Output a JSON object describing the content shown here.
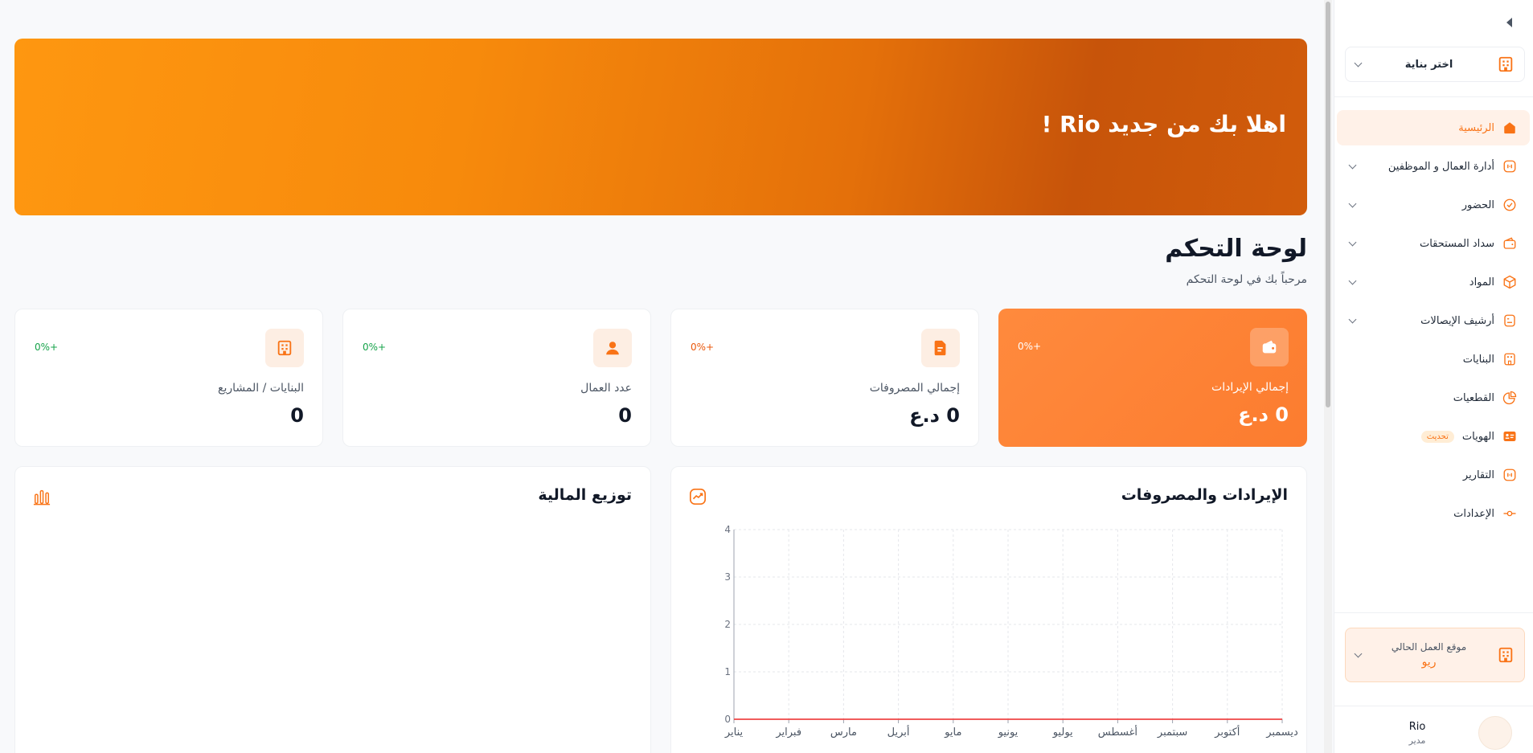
{
  "sidebar": {
    "building_select": {
      "label": "اختر بناية"
    },
    "nav": [
      {
        "label": "الرئيسية",
        "active": true,
        "icon": "home-icon",
        "has_submenu": false
      },
      {
        "label": "أدارة العمال و الموظفين",
        "icon": "users-icon",
        "has_submenu": true
      },
      {
        "label": "الحضور",
        "icon": "check-circle-icon",
        "has_submenu": true
      },
      {
        "label": "سداد المستحقات",
        "icon": "wallet-icon",
        "has_submenu": true
      },
      {
        "label": "المواد",
        "icon": "box-icon",
        "has_submenu": true
      },
      {
        "label": "أرشيف الإيصالات",
        "icon": "receipt-icon",
        "has_submenu": true
      },
      {
        "label": "البنايات",
        "icon": "building-icon",
        "has_submenu": false
      },
      {
        "label": "القطعيات",
        "icon": "pie-icon",
        "has_submenu": false
      },
      {
        "label": "الهويات",
        "icon": "id-card-icon",
        "has_submenu": false,
        "badge": "تحديث"
      },
      {
        "label": "التقارير",
        "icon": "report-icon",
        "has_submenu": false
      },
      {
        "label": "الإعدادات",
        "icon": "settings-icon",
        "has_submenu": false
      }
    ],
    "location": {
      "title": "موقع العمل الحالي",
      "value": "ريو"
    },
    "user": {
      "name": "Rio",
      "role": "مدير"
    }
  },
  "banner": {
    "greeting": "اهلا بك من جديد Rio !"
  },
  "page": {
    "title": "لوحة التحكم",
    "subtitle": "مرحباً بك في لوحة التحكم"
  },
  "stats": [
    {
      "label": "إجمالي الإيرادات",
      "value": "0 د.ع",
      "change": "+0%",
      "icon": "wallet-icon"
    },
    {
      "label": "إجمالي المصروفات",
      "value": "0 د.ع",
      "change": "+0%",
      "icon": "document-icon"
    },
    {
      "label": "عدد العمال",
      "value": "0",
      "change": "+0%",
      "icon": "user-icon"
    },
    {
      "label": "البنايات / المشاريع",
      "value": "0",
      "change": "+0%",
      "icon": "building-icon"
    }
  ],
  "panels": {
    "revenue_expense": {
      "title": "الإيرادات والمصروفات",
      "icon": "trend-icon"
    },
    "finance_distribution": {
      "title": "توزيع المالية",
      "icon": "bar-chart-icon"
    }
  },
  "colors": {
    "accent": "#f97316",
    "accent_light": "#fff1e8",
    "positive": "#16a34a"
  },
  "chart_data": {
    "type": "line",
    "categories": [
      "يناير",
      "فبراير",
      "مارس",
      "أبريل",
      "مايو",
      "يونيو",
      "يوليو",
      "أغسطس",
      "سبتمبر",
      "أكتوبر",
      "ديسمبر"
    ],
    "series": [
      {
        "values": [
          0,
          0,
          0,
          0,
          0,
          0,
          0,
          0,
          0,
          0,
          0
        ],
        "color": "#ef4444"
      }
    ],
    "ylim": [
      0,
      4
    ],
    "yticks": [
      "0",
      "1",
      "2",
      "3",
      "4"
    ],
    "grid": true
  }
}
